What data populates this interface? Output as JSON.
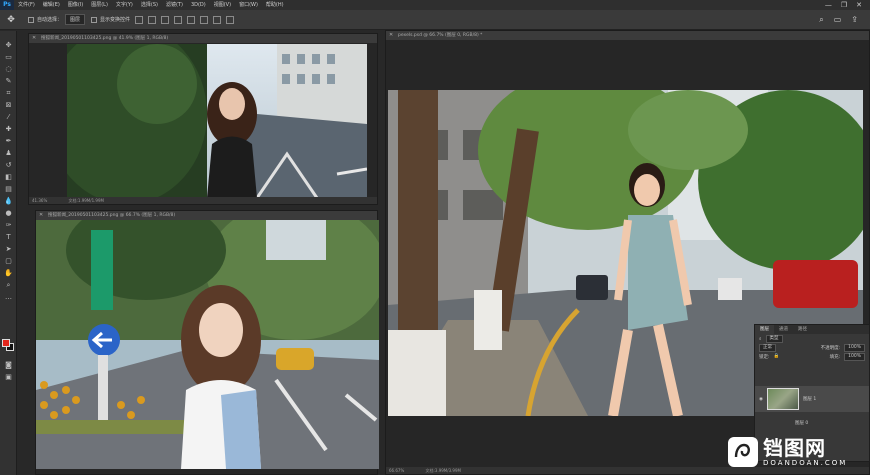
{
  "menubar": {
    "logo": "Ps",
    "items": [
      "文件(F)",
      "编辑(E)",
      "图像(I)",
      "图层(L)",
      "文字(Y)",
      "选择(S)",
      "滤镜(T)",
      "3D(D)",
      "视图(V)",
      "窗口(W)",
      "帮助(H)"
    ],
    "minimize": "—",
    "maximize": "❐",
    "close": "✕"
  },
  "options": {
    "move_glyph": "✥",
    "auto_select_label": "自动选择：",
    "auto_select_value": "图层",
    "show_transform_label": "显示变换控件",
    "search": "⌕",
    "workspace": "▭",
    "share": "⇪"
  },
  "documents": {
    "doc1": {
      "title": "搜狐新闻_20190501103425.png @ 41.9% (图层 1, RGB/8)",
      "status_zoom": "41.36%",
      "status_doc": "文档:1.99M/1.99M"
    },
    "doc2": {
      "title": "搜狐新闻_20190501103425.png @ 66.7% (图层 1, RGB/8)",
      "status_zoom": "66.67%",
      "status_doc": "文档:1.99M/1.99M"
    },
    "doc3": {
      "title": "pexels.psd @ 66.7% (图层 0, RGB/8) *",
      "status_zoom": "66.67%",
      "status_doc": "文档:3.99M/3.99M"
    }
  },
  "layers_panel": {
    "tabs": [
      "图层",
      "通道",
      "路径"
    ],
    "kind_label": "类型",
    "blend_mode": "正常",
    "opacity_label": "不透明度:",
    "opacity_value": "100%",
    "lock_label": "锁定:",
    "fill_label": "填充:",
    "fill_value": "100%",
    "layer_name": "图层 1",
    "background_layer": "图层 0"
  },
  "watermark": {
    "cn": "铛图网",
    "en": "DOANDOAN.COM"
  },
  "colors": {
    "foreground": "#e1251b",
    "background": "#111111",
    "accent": "#31a8ff"
  }
}
